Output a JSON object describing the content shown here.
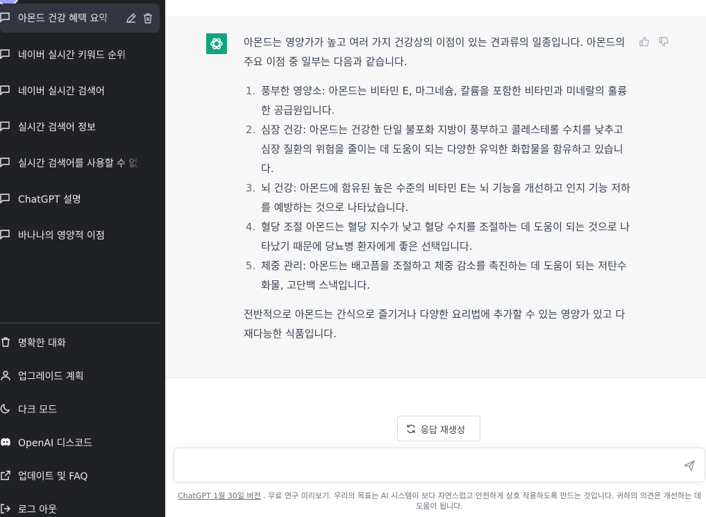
{
  "sidebar": {
    "conversations": [
      {
        "label": "아몬드 건강 혜택 요약",
        "icon": "chat-bubble-icon",
        "active": true
      },
      {
        "label": "네이버 실시간 키워드 순위",
        "icon": "chat-bubble-icon"
      },
      {
        "label": "네이버 실시간 검색어",
        "icon": "chat-bubble-icon"
      },
      {
        "label": "실시간 검색어 정보",
        "icon": "chat-bubble-icon"
      },
      {
        "label": "실시간 검색어를 사용할 수 없",
        "icon": "chat-bubble-icon"
      },
      {
        "label": "ChatGPT 설명",
        "icon": "chat-bubble-icon"
      },
      {
        "label": "바나나의 영양적 이점",
        "icon": "chat-bubble-icon"
      }
    ],
    "menu": [
      {
        "label": "명확한 대화",
        "icon": "trash-icon"
      },
      {
        "label": "업그레이드 계획",
        "icon": "user-icon"
      },
      {
        "label": "다크  모드",
        "icon": "moon-icon"
      },
      {
        "label": "OpenAI 디스코드",
        "icon": "discord-icon"
      },
      {
        "label": "업데이트 및 FAQ",
        "icon": "external-link-icon"
      },
      {
        "label": "로그 아웃",
        "icon": "logout-icon"
      }
    ]
  },
  "answer": {
    "intro": "아몬드는 영양가가 높고 여러 가지 건강상의 이점이 있는 견과류의 일종입니다. 아몬드의 주요 이점 중 일부는 다음과 같습니다.",
    "items": [
      "풍부한 영양소: 아몬드는 비타민 E, 마그네슘, 칼륨을 포함한 비타민과 미네랄의 훌륭한 공급원입니다.",
      "심장 건강: 아몬드는 건강한 단일 불포화 지방이 풍부하고 콜레스테롤 수치를 낮추고 심장 질환의 위험을 줄이는 데 도움이 되는 다양한 유익한 화합물을 함유하고 있습니다.",
      "뇌 건강: 아몬드에 함유된 높은 수준의 비타민 E는 뇌 기능을 개선하고 인지 기능 저하를 예방하는 것으로 나타났습니다.",
      "혈당 조절 아몬드는 혈당 지수가 낮고 혈당 수치를 조절하는 데 도움이 되는 것으로 나타났기 때문에 당뇨병 환자에게 좋은 선택입니다.",
      "체중 관리: 아몬드는 배고픔을 조절하고 체중 감소를 촉진하는 데 도움이 되는 저탄수화물, 고단백 스낵입니다."
    ],
    "outro": "전반적으로 아몬드는 간식으로 즐기거나 다양한 요리법에 추가할 수 있는 영양가 있고 다재다능한 식품입니다."
  },
  "regenerate_label": "응답 재생성",
  "input": {
    "value": "",
    "placeholder": ""
  },
  "footer": {
    "version_link": "ChatGPT 1월 30일 버전",
    "text": ". 무료 연구 미리보기. 우리의 목표는 AI 시스템이 보다 자연스럽고 안전하게 상호 작용하도록 만드는 것입니다. 귀하의 의견은 개선하는 데 도움이 됩니다."
  },
  "colors": {
    "sidebar_bg": "#202123",
    "accent": "#10a37f",
    "answer_bg": "#f7f7f8"
  }
}
